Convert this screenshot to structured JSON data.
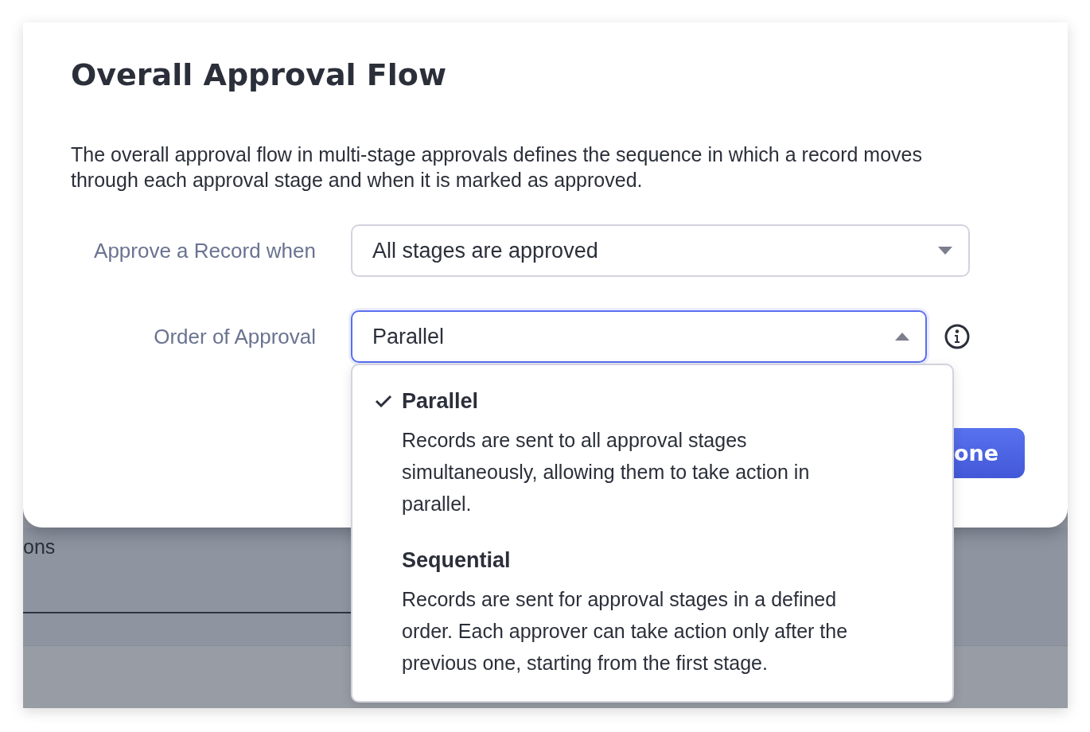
{
  "dialog": {
    "title": "Overall Approval Flow",
    "description": "The overall approval flow in multi-stage approvals defines the sequence in which a record moves through each approval stage and when it is marked as approved.",
    "fields": [
      {
        "label": "Approve a Record when",
        "value": "All stages are approved",
        "expanded": false,
        "info": false
      },
      {
        "label": "Order of Approval",
        "value": "Parallel",
        "expanded": true,
        "info": true
      }
    ],
    "button": "one"
  },
  "dropdown_menu": [
    {
      "title": "Parallel",
      "description": "Records are sent to all approval stages simultaneously, allowing them to take action in parallel.",
      "selected": true
    },
    {
      "title": "Sequential",
      "description": "Records are sent for approval stages in a defined order. Each approver can take action only after the previous one, starting from the first stage.",
      "selected": false
    }
  ],
  "background": {
    "section_text": "ons"
  }
}
